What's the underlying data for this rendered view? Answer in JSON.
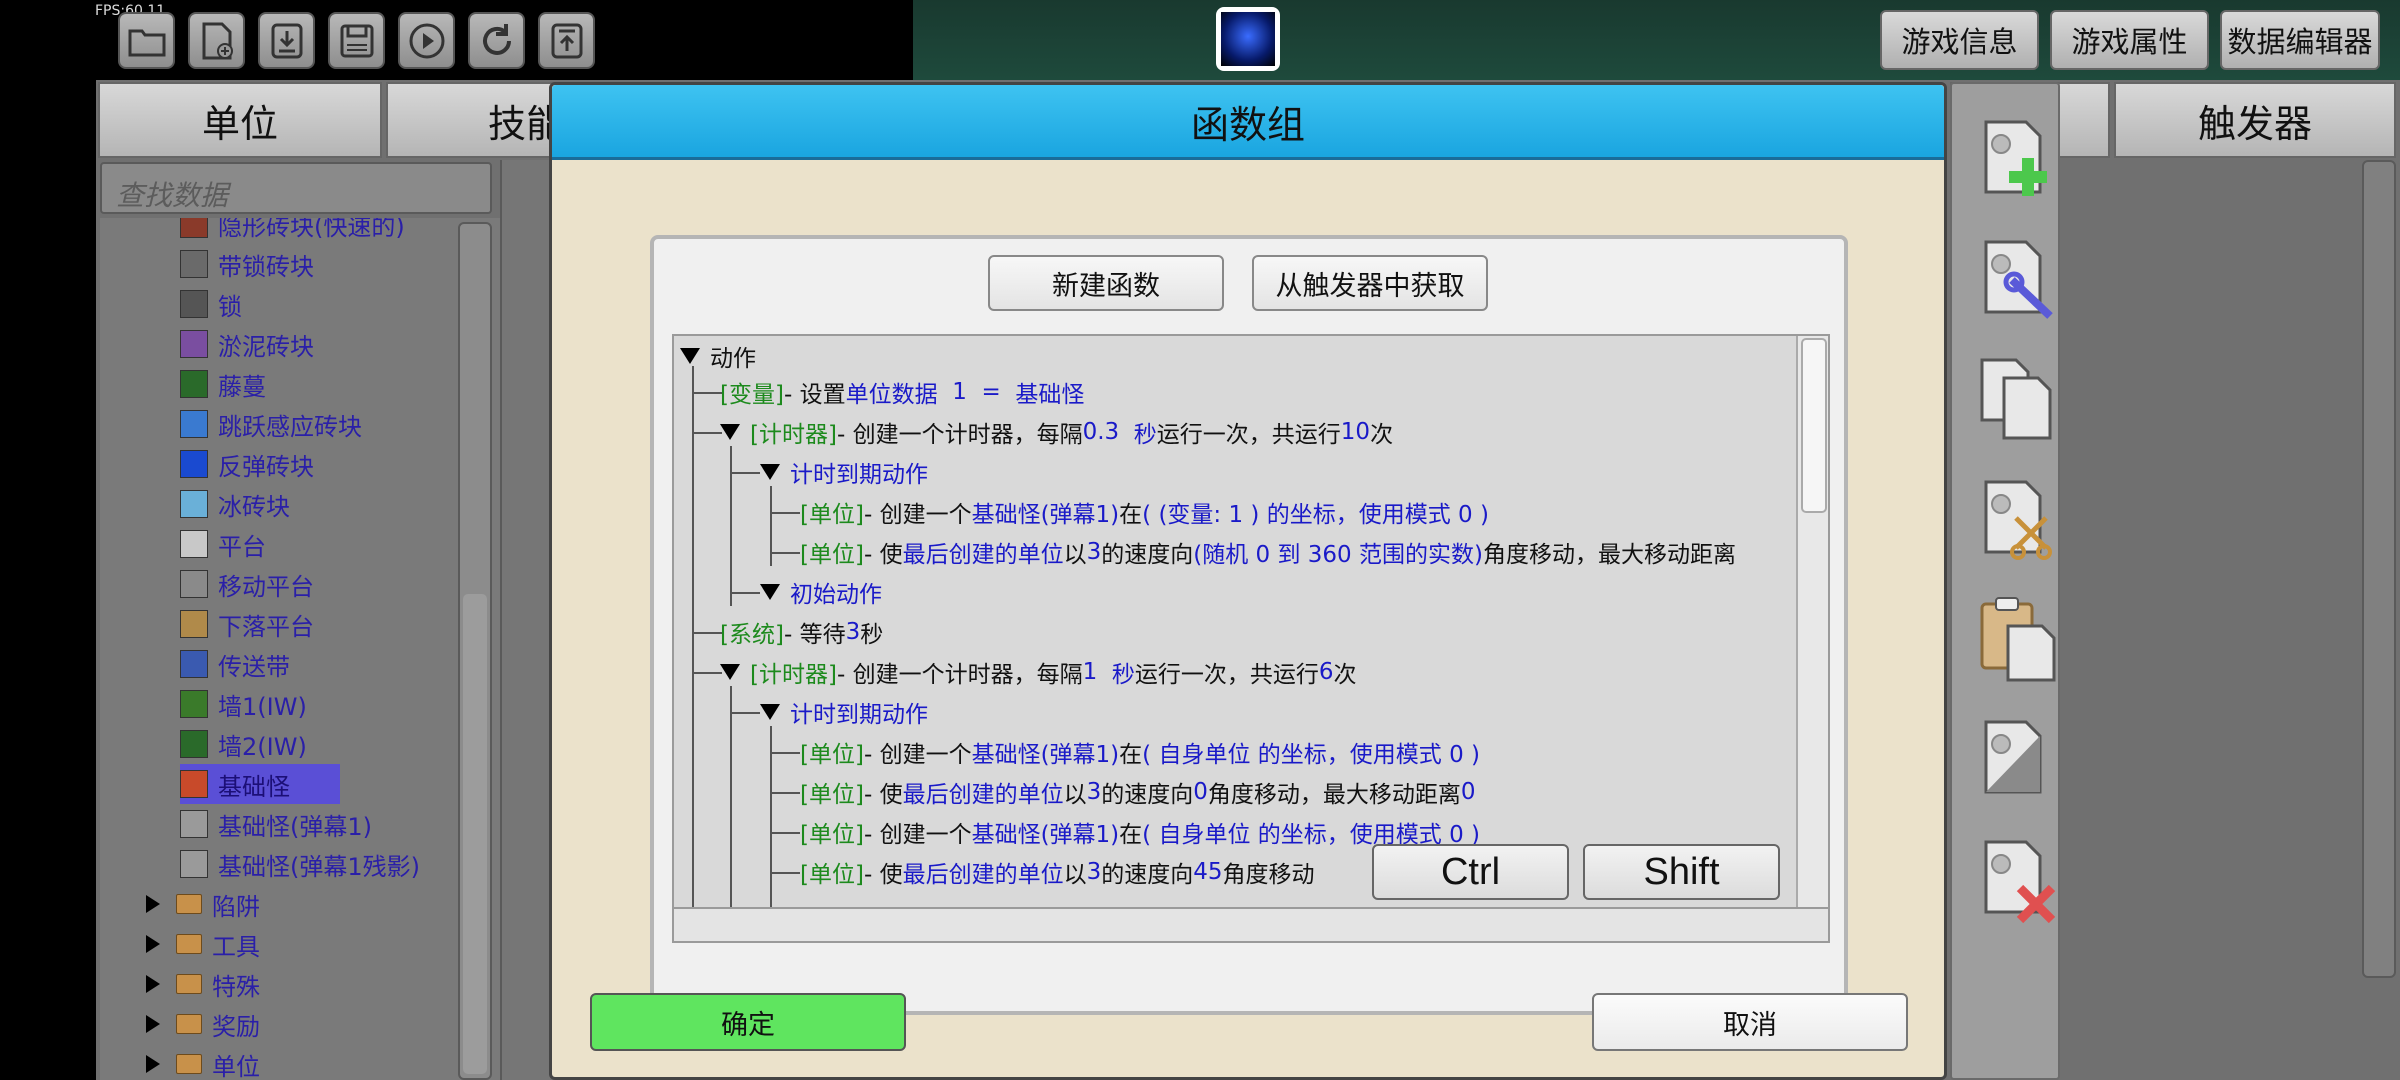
{
  "hud": {
    "fps": "FPS:60.11"
  },
  "toolbar": {
    "icons": [
      "folder-open-icon",
      "new-file-icon",
      "download-icon",
      "save-icon",
      "play-icon",
      "refresh-icon",
      "upload-icon"
    ]
  },
  "top_buttons": {
    "game_info": "游戏信息",
    "game_props": "游戏属性",
    "data_editor": "数据编辑器"
  },
  "panel_tabs": {
    "unit": "单位",
    "skill": "技能",
    "trigger": "触发器"
  },
  "search": {
    "placeholder": "查找数据"
  },
  "tree": {
    "items": [
      {
        "label": "隐形砖块(快速的)",
        "icon_color": "#8a3a2a"
      },
      {
        "label": "带锁砖块",
        "icon_color": "#6a6a6a"
      },
      {
        "label": "锁",
        "icon_color": "#555555"
      },
      {
        "label": "淤泥砖块",
        "icon_color": "#7a4ea0"
      },
      {
        "label": "藤蔓",
        "icon_color": "#2a6a2a"
      },
      {
        "label": "跳跃感应砖块",
        "icon_color": "#3a7ad0"
      },
      {
        "label": "反弹砖块",
        "icon_color": "#1a4ad0"
      },
      {
        "label": "冰砖块",
        "icon_color": "#6ab0d8"
      },
      {
        "label": "平台",
        "icon_color": "#c8c8c8"
      },
      {
        "label": "移动平台",
        "icon_color": "#8a8a8a"
      },
      {
        "label": "下落平台",
        "icon_color": "#b08a4a"
      },
      {
        "label": "传送带",
        "icon_color": "#3a5ab0"
      },
      {
        "label": "墙1(IW)",
        "icon_color": "#3a7a2a"
      },
      {
        "label": "墙2(IW)",
        "icon_color": "#2a6a2a"
      },
      {
        "label": "基础怪",
        "icon_color": "#c84a2a"
      },
      {
        "label": "基础怪(弹幕1)",
        "icon_color": "#9a9a9a"
      },
      {
        "label": "基础怪(弹幕1残影)",
        "icon_color": "#9a9a9a"
      }
    ],
    "folders": [
      "陷阱",
      "工具",
      "特殊",
      "奖励",
      "单位"
    ]
  },
  "modal": {
    "title": "函数组",
    "new_function": "新建函数",
    "get_from_trigger": "从触发器中获取",
    "ok": "确定",
    "cancel": "取消",
    "keys": {
      "ctrl": "Ctrl",
      "shift": "Shift"
    }
  },
  "code": {
    "root": "动作",
    "l1": {
      "tag": "[变量]",
      "a": " - 设置 ",
      "b": "单位数据",
      "c": "1",
      "d": "=",
      "e": "基础怪"
    },
    "l2": {
      "tag": "[计时器]",
      "a": " - 创建一个计时器，每隔 ",
      "b": "0.3",
      "c": "秒",
      "d": " 运行一次，共运行 ",
      "e": "10",
      "f": " 次"
    },
    "l3": {
      "label": "计时到期动作"
    },
    "l4": {
      "tag": "[单位]",
      "a": " - 创建一个 ",
      "b": "基础怪(弹幕1)",
      "c": " 在 ",
      "d": "( (变量: 1 ) 的坐标，使用模式 0 )"
    },
    "l5": {
      "tag": "[单位]",
      "a": " - 使 ",
      "b": "最后创建的单位",
      "c": " 以 ",
      "d": "3",
      "e": " 的速度向 ",
      "f": "(随机 0 到 360 范围的实数)",
      "g": " 角度移动，最大移动距离"
    },
    "l6": {
      "label": "初始动作"
    },
    "l7": {
      "tag": "[系统]",
      "a": " - 等待 ",
      "b": "3",
      "c": " 秒"
    },
    "l8": {
      "tag": "[计时器]",
      "a": " - 创建一个计时器，每隔 ",
      "b": "1",
      "c": "秒",
      "d": " 运行一次，共运行 ",
      "e": "6",
      "f": " 次"
    },
    "l9": {
      "label": "计时到期动作"
    },
    "l10": {
      "tag": "[单位]",
      "a": " - 创建一个 ",
      "b": "基础怪(弹幕1)",
      "c": " 在 ",
      "d": "( 自身单位 的坐标，使用模式 0 )"
    },
    "l11": {
      "tag": "[单位]",
      "a": " - 使 ",
      "b": "最后创建的单位",
      "c": " 以 ",
      "d": "3",
      "e": " 的速度向 ",
      "f": "0",
      "g": " 角度移动，最大移动距离 ",
      "h": "0"
    },
    "l12": {
      "tag": "[单位]",
      "a": " - 创建一个 ",
      "b": "基础怪(弹幕1)",
      "c": " 在 ",
      "d": "( 自身单位 的坐标，使用模式 0 )"
    },
    "l13": {
      "tag": "[单位]",
      "a": " - 使 ",
      "b": "最后创建的单位",
      "c": " 以 ",
      "d": "3",
      "e": " 的速度向 ",
      "f": "45",
      "g": " 角度移动"
    }
  }
}
